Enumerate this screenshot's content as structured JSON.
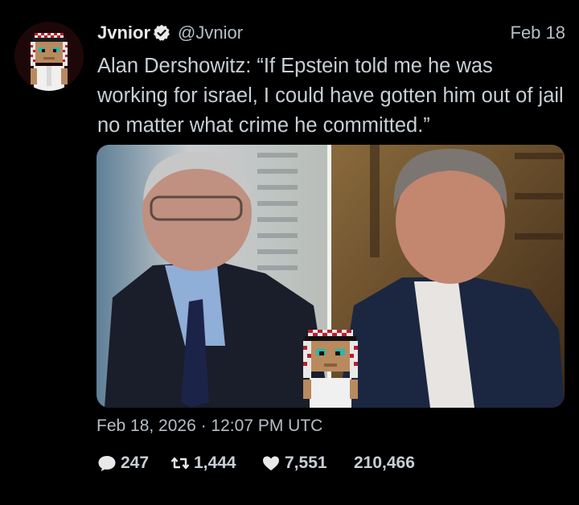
{
  "author": {
    "display_name": "Jvnior",
    "handle": "@Jvnior",
    "verified": true,
    "verified_color": "#ffffff",
    "avatar_icon": "pixel-keffiyeh-character-avatar"
  },
  "tweet": {
    "date_short": "Feb 18",
    "text": "Alan Dershowitz: “If Epstein told me he was working for israel, I could have gotten him out of jail no matter what crime he committed.”",
    "timestamp": "Feb 18, 2026 · 12:07 PM UTC"
  },
  "media": {
    "description_icon": "split-screen-video-still",
    "overlay_icon": "pixel-keffiyeh-character"
  },
  "stats": {
    "replies": "247",
    "retweets": "1,444",
    "likes": "7,551",
    "views": "210,466"
  },
  "colors": {
    "background": "#000000",
    "text": "#e7e9ea",
    "secondary_text": "#b6bec6"
  }
}
